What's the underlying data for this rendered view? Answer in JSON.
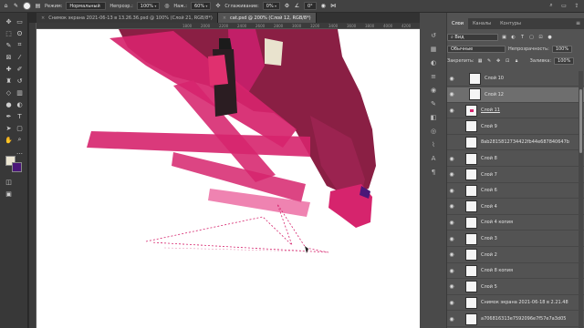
{
  "options_bar": {
    "mode_label": "Режим:",
    "mode_value": "Нормальный",
    "opacity_label": "Непрозр.:",
    "opacity_value": "100%",
    "pressure_label": "Наж.:",
    "pressure_value": "60%",
    "smoothing_label": "Сглаживание:",
    "smoothing_value": "0%",
    "angle_value": "0°",
    "icons": [
      "brush-icon",
      "brush-preset-icon",
      "brush-settings-icon",
      "pressure-opacity-icon",
      "airbrush-icon",
      "symmetry-icon",
      "search-icon",
      "workspace-icon"
    ]
  },
  "tabs": [
    {
      "label": "Снимок экрана 2021-06-13 в 13.26.36.psd @ 100% (Слой 21, RGB/8*)",
      "active": false
    },
    {
      "label": "cat.psd @ 200% (Слой 12, RGB/8*)",
      "active": true
    }
  ],
  "ruler": {
    "ticks": [
      "",
      "",
      "",
      "",
      "",
      "",
      "",
      "",
      "1800",
      "2000",
      "2200",
      "2400",
      "2600",
      "2800",
      "3000",
      "3200",
      "3400",
      "3600",
      "3800",
      "4000",
      "4200"
    ]
  },
  "colors": {
    "foreground": "#ece6d2",
    "background": "#4b1778",
    "accent_pink": "#d6246d",
    "maroon": "#8a1f44"
  },
  "layers_panel": {
    "tabs": [
      "Слои",
      "Каналы",
      "Контуры"
    ],
    "filter_label": "Вид",
    "blend_mode": "Обычные",
    "opacity_label": "Непрозрачность:",
    "opacity_value": "100%",
    "lock_label": "Закрепить:",
    "fill_label": "Заливка:",
    "fill_value": "100%",
    "layers": [
      {
        "name": "Слой 10",
        "visible": true,
        "selected": false,
        "mark": false,
        "indent": true
      },
      {
        "name": "Слой 12",
        "visible": true,
        "selected": true,
        "mark": false,
        "indent": true
      },
      {
        "name": "Слой 11",
        "visible": true,
        "selected": false,
        "mark": true,
        "indent": false,
        "underline": true
      },
      {
        "name": "Слой 9",
        "visible": false,
        "selected": false,
        "mark": false,
        "indent": false
      },
      {
        "name": "8ab2815812734422fb44e687840647b",
        "visible": false,
        "selected": false,
        "mark": false,
        "indent": false
      },
      {
        "name": "Слой 8",
        "visible": true,
        "selected": false,
        "mark": false,
        "indent": false
      },
      {
        "name": "Слой 7",
        "visible": true,
        "selected": false,
        "mark": false,
        "indent": false
      },
      {
        "name": "Слой 6",
        "visible": true,
        "selected": false,
        "mark": false,
        "indent": false
      },
      {
        "name": "Слой 4",
        "visible": true,
        "selected": false,
        "mark": false,
        "indent": false
      },
      {
        "name": "Слой 4 копия",
        "visible": true,
        "selected": false,
        "mark": false,
        "indent": false
      },
      {
        "name": "Слой 3",
        "visible": true,
        "selected": false,
        "mark": false,
        "indent": false
      },
      {
        "name": "Слой 2",
        "visible": true,
        "selected": false,
        "mark": false,
        "indent": false
      },
      {
        "name": "Слой 8 копия",
        "visible": true,
        "selected": false,
        "mark": false,
        "indent": false
      },
      {
        "name": "Слой 5",
        "visible": true,
        "selected": false,
        "mark": false,
        "indent": false
      },
      {
        "name": "Снимок экрана 2021-06-18 в 2.21.48",
        "visible": true,
        "selected": false,
        "mark": false,
        "indent": false
      },
      {
        "name": "a706816313e7592096e7f57e7a3d05",
        "visible": true,
        "selected": false,
        "mark": false,
        "indent": false
      }
    ]
  }
}
